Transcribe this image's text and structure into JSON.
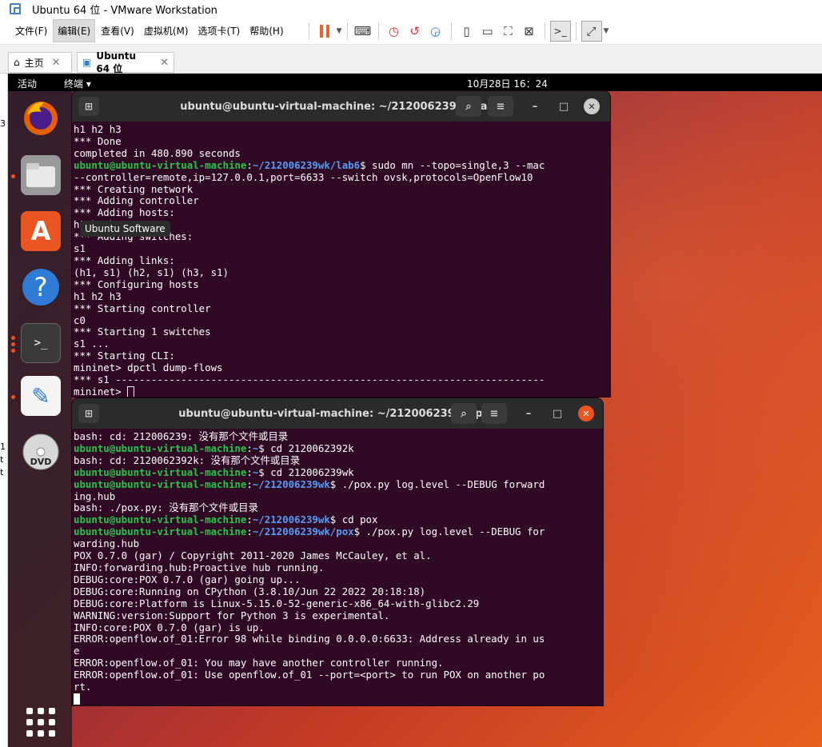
{
  "window": {
    "title": "Ubuntu 64 位 - VMware Workstation"
  },
  "menu": [
    "文件(F)",
    "编辑(E)",
    "查看(V)",
    "虚拟机(M)",
    "选项卡(T)",
    "帮助(H)"
  ],
  "tabs": {
    "home": "主页",
    "vm": "Ubuntu 64 位"
  },
  "topbar": {
    "activities": "活动",
    "app": "终端 ▾",
    "clock": "10月28日  16：24"
  },
  "tooltip": "Ubuntu Software",
  "left_strip": [
    "3",
    "1",
    "t",
    "t"
  ],
  "term1": {
    "title": "ubuntu@ubuntu-virtual-machine: ~/212006239wk/lab6",
    "lines": [
      [
        [
          "",
          "h1 h2 h3"
        ]
      ],
      [
        [
          "",
          "*** Done"
        ]
      ],
      [
        [
          "",
          "completed in 480.890 seconds"
        ]
      ],
      [
        [
          "g",
          "ubuntu@ubuntu-virtual-machine"
        ],
        [
          "",
          ":"
        ],
        [
          "b",
          "~/212006239wk/lab6"
        ],
        [
          "",
          "$ sudo mn --topo=single,3 --mac"
        ]
      ],
      [
        [
          "",
          "--controller=remote,ip=127.0.0.1,port=6633 --switch ovsk,protocols=OpenFlow10"
        ]
      ],
      [
        [
          "",
          "*** Creating network"
        ]
      ],
      [
        [
          "",
          "*** Adding controller"
        ]
      ],
      [
        [
          "",
          "*** Adding hosts:"
        ]
      ],
      [
        [
          "",
          "h1 h2 h3"
        ]
      ],
      [
        [
          "",
          "*** Adding switches:"
        ]
      ],
      [
        [
          "",
          "s1"
        ]
      ],
      [
        [
          "",
          "*** Adding links:"
        ]
      ],
      [
        [
          "",
          "(h1, s1) (h2, s1) (h3, s1)"
        ]
      ],
      [
        [
          "",
          "*** Configuring hosts"
        ]
      ],
      [
        [
          "",
          "h1 h2 h3"
        ]
      ],
      [
        [
          "",
          "*** Starting controller"
        ]
      ],
      [
        [
          "",
          "c0"
        ]
      ],
      [
        [
          "",
          "*** Starting 1 switches"
        ]
      ],
      [
        [
          "",
          "s1 ..."
        ]
      ],
      [
        [
          "",
          "*** Starting CLI:"
        ]
      ],
      [
        [
          "",
          "mininet> dpctl dump-flows"
        ]
      ],
      [
        [
          "",
          "*** s1 ------------------------------------------------------------------------"
        ]
      ],
      [
        [
          "",
          "mininet> "
        ]
      ]
    ]
  },
  "term2": {
    "title": "ubuntu@ubuntu-virtual-machine: ~/212006239wk/pox",
    "lines": [
      [
        [
          "",
          "bash: cd: 212006239: 没有那个文件或目录"
        ]
      ],
      [
        [
          "g",
          "ubuntu@ubuntu-virtual-machine"
        ],
        [
          "",
          ":"
        ],
        [
          "b",
          "~"
        ],
        [
          "",
          "$ cd 2120062392k"
        ]
      ],
      [
        [
          "",
          "bash: cd: 2120062392k: 没有那个文件或目录"
        ]
      ],
      [
        [
          "g",
          "ubuntu@ubuntu-virtual-machine"
        ],
        [
          "",
          ":"
        ],
        [
          "b",
          "~"
        ],
        [
          "",
          "$ cd 212006239wk"
        ]
      ],
      [
        [
          "g",
          "ubuntu@ubuntu-virtual-machine"
        ],
        [
          "",
          ":"
        ],
        [
          "b",
          "~/212006239wk"
        ],
        [
          "",
          "$ ./pox.py log.level --DEBUG forward"
        ]
      ],
      [
        [
          "",
          "ing.hub"
        ]
      ],
      [
        [
          "",
          "bash: ./pox.py: 没有那个文件或目录"
        ]
      ],
      [
        [
          "g",
          "ubuntu@ubuntu-virtual-machine"
        ],
        [
          "",
          ":"
        ],
        [
          "b",
          "~/212006239wk"
        ],
        [
          "",
          "$ cd pox"
        ]
      ],
      [
        [
          "g",
          "ubuntu@ubuntu-virtual-machine"
        ],
        [
          "",
          ":"
        ],
        [
          "b",
          "~/212006239wk/pox"
        ],
        [
          "",
          "$ ./pox.py log.level --DEBUG for"
        ]
      ],
      [
        [
          "",
          "warding.hub"
        ]
      ],
      [
        [
          "",
          "POX 0.7.0 (gar) / Copyright 2011-2020 James McCauley, et al."
        ]
      ],
      [
        [
          "",
          "INFO:forwarding.hub:Proactive hub running."
        ]
      ],
      [
        [
          "",
          "DEBUG:core:POX 0.7.0 (gar) going up..."
        ]
      ],
      [
        [
          "",
          "DEBUG:core:Running on CPython (3.8.10/Jun 22 2022 20:18:18)"
        ]
      ],
      [
        [
          "",
          "DEBUG:core:Platform is Linux-5.15.0-52-generic-x86_64-with-glibc2.29"
        ]
      ],
      [
        [
          "",
          "WARNING:version:Support for Python 3 is experimental."
        ]
      ],
      [
        [
          "",
          "INFO:core:POX 0.7.0 (gar) is up."
        ]
      ],
      [
        [
          "",
          "ERROR:openflow.of_01:Error 98 while binding 0.0.0.0:6633: Address already in us"
        ]
      ],
      [
        [
          "",
          "e"
        ]
      ],
      [
        [
          "",
          "ERROR:openflow.of_01: You may have another controller running."
        ]
      ],
      [
        [
          "",
          "ERROR:openflow.of_01: Use openflow.of_01 --port=<port> to run POX on another po"
        ]
      ],
      [
        [
          "",
          "rt."
        ]
      ],
      [
        [
          "",
          ""
        ]
      ]
    ]
  }
}
